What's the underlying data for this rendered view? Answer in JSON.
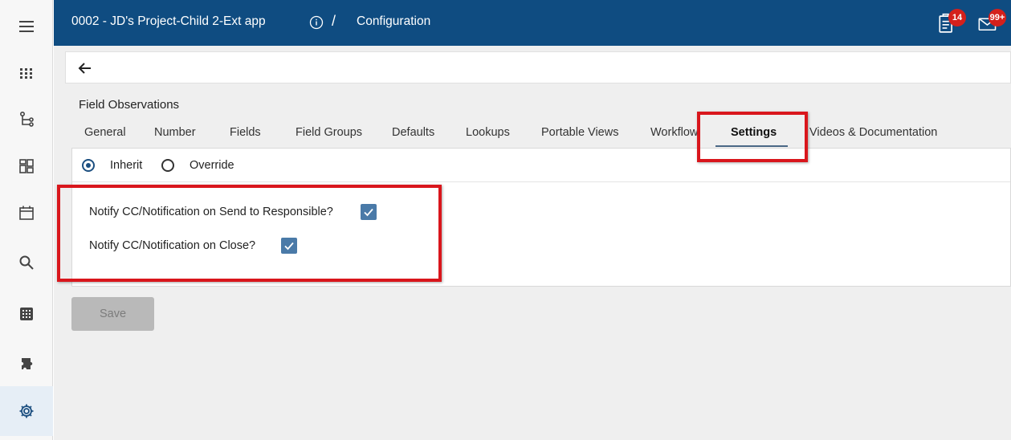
{
  "header": {
    "app_title": "0002 - JD's Project-Child 2-Ext app",
    "separator": "/",
    "page_title": "Configuration",
    "tasks_badge": "14",
    "mail_badge": "99+"
  },
  "rail": {
    "items": [
      "menu-icon",
      "apps-grid-icon",
      "workflow-tree-icon",
      "dashboard-icon",
      "calendar-icon",
      "search-icon",
      "keypad-icon",
      "extension-icon",
      "settings-gear-icon"
    ],
    "active": "settings-gear-icon"
  },
  "section": {
    "title": "Field Observations"
  },
  "tabs": [
    {
      "label": "General"
    },
    {
      "label": "Number"
    },
    {
      "label": "Fields"
    },
    {
      "label": "Field Groups"
    },
    {
      "label": "Defaults"
    },
    {
      "label": "Lookups"
    },
    {
      "label": "Portable Views"
    },
    {
      "label": "Workflow"
    },
    {
      "label": "Settings",
      "active": true
    },
    {
      "label": "Videos & Documentation"
    }
  ],
  "mode": {
    "options": [
      {
        "label": "Inherit",
        "selected": true
      },
      {
        "label": "Override",
        "selected": false
      }
    ]
  },
  "settings": [
    {
      "label": "Notify CC/Notification on Send to Responsible?",
      "checked": true
    },
    {
      "label": "Notify CC/Notification on Close?",
      "checked": true
    }
  ],
  "actions": {
    "save_label": "Save",
    "save_disabled": true
  },
  "colors": {
    "header": "#0f4c81",
    "checkbox": "#4a7aa8",
    "highlight": "#d9161c",
    "badge": "#d4201c"
  }
}
